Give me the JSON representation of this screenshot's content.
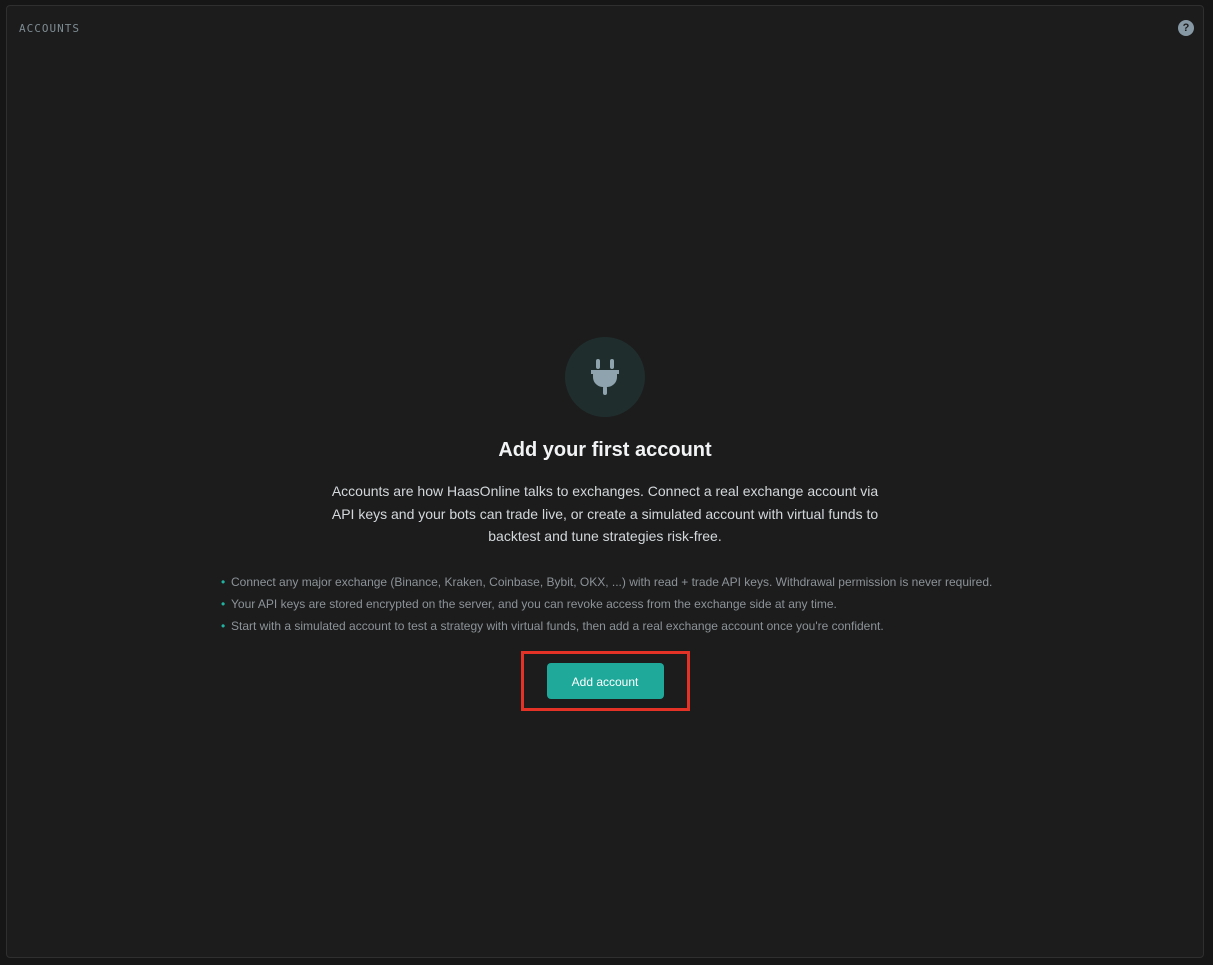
{
  "panel": {
    "title": "ACCOUNTS",
    "help_icon": "question-mark-icon",
    "help_glyph": "?"
  },
  "empty_state": {
    "icon": "plug-icon",
    "headline": "Add your first account",
    "description": "Accounts are how HaasOnline talks to exchanges. Connect a real exchange account via API keys and your bots can trade live, or create a simulated account with virtual funds to backtest and tune strategies risk-free.",
    "bullet_glyph": "•",
    "tips": [
      "Connect any major exchange (Binance, Kraken, Coinbase, Bybit, OKX, ...) with read + trade API keys. Withdrawal permission is never required.",
      "Your API keys are stored encrypted on the server, and you can revoke access from the exchange side at any time.",
      "Start with a simulated account to test a strategy with virtual funds, then add a real exchange account once you're confident."
    ],
    "button_label": "Add account"
  },
  "colors": {
    "background": "#1c1c1c",
    "accent": "#1fa99a",
    "highlight_border": "#e53227"
  }
}
